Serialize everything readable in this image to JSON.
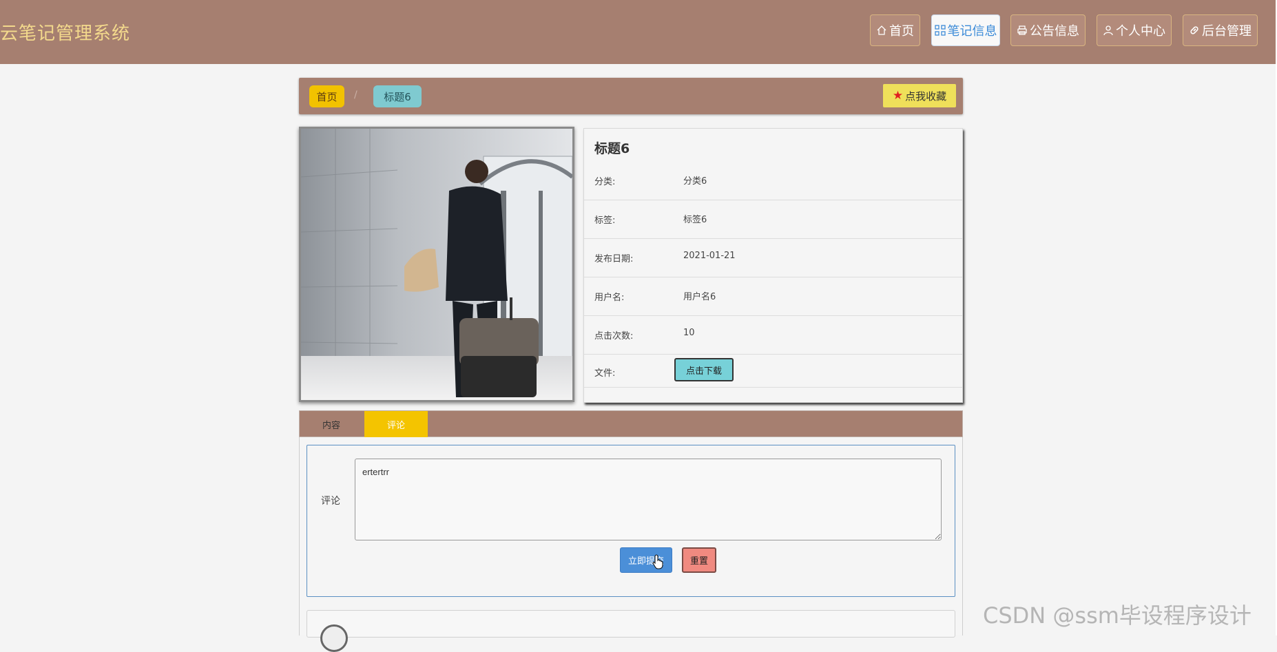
{
  "header": {
    "site_title": "云笔记管理系统",
    "nav": [
      {
        "label": "首页",
        "icon": "home-icon",
        "active": false
      },
      {
        "label": "笔记信息",
        "icon": "grid-icon",
        "active": true
      },
      {
        "label": "公告信息",
        "icon": "print-icon",
        "active": false
      },
      {
        "label": "个人中心",
        "icon": "user-icon",
        "active": false
      },
      {
        "label": "后台管理",
        "icon": "link-icon",
        "active": false
      }
    ]
  },
  "breadcrumb": {
    "home": "首页",
    "separator": "/",
    "current": "标题6",
    "favorite_label": "点我收藏",
    "favorite_icon": "star-icon"
  },
  "detail": {
    "title": "标题6",
    "rows": [
      {
        "key": "分类:",
        "value": "分类6"
      },
      {
        "key": "标签:",
        "value": "标签6"
      },
      {
        "key": "发布日期:",
        "value": "2021-01-21"
      },
      {
        "key": "用户名:",
        "value": "用户名6"
      },
      {
        "key": "点击次数:",
        "value": "10"
      }
    ],
    "file_key": "文件:",
    "download_label": "点击下载"
  },
  "tabs": [
    {
      "label": "内容",
      "active": false
    },
    {
      "label": "评论",
      "active": true
    }
  ],
  "comment_form": {
    "label": "评论",
    "value": "ertertrr",
    "submit_label": "立即提交",
    "reset_label": "重置"
  },
  "watermark": "CSDN @ssm毕设程序设计",
  "colors": {
    "header_bg": "#a67f70",
    "title_color": "#f3d98c",
    "home_crumb": "#f2c200",
    "current_crumb": "#7fcad0",
    "favorite_btn": "#efe05a",
    "active_tab": "#f4c400",
    "submit_btn": "#4b8fd8",
    "reset_btn": "#f08a80",
    "download_btn": "#77d1d8"
  }
}
